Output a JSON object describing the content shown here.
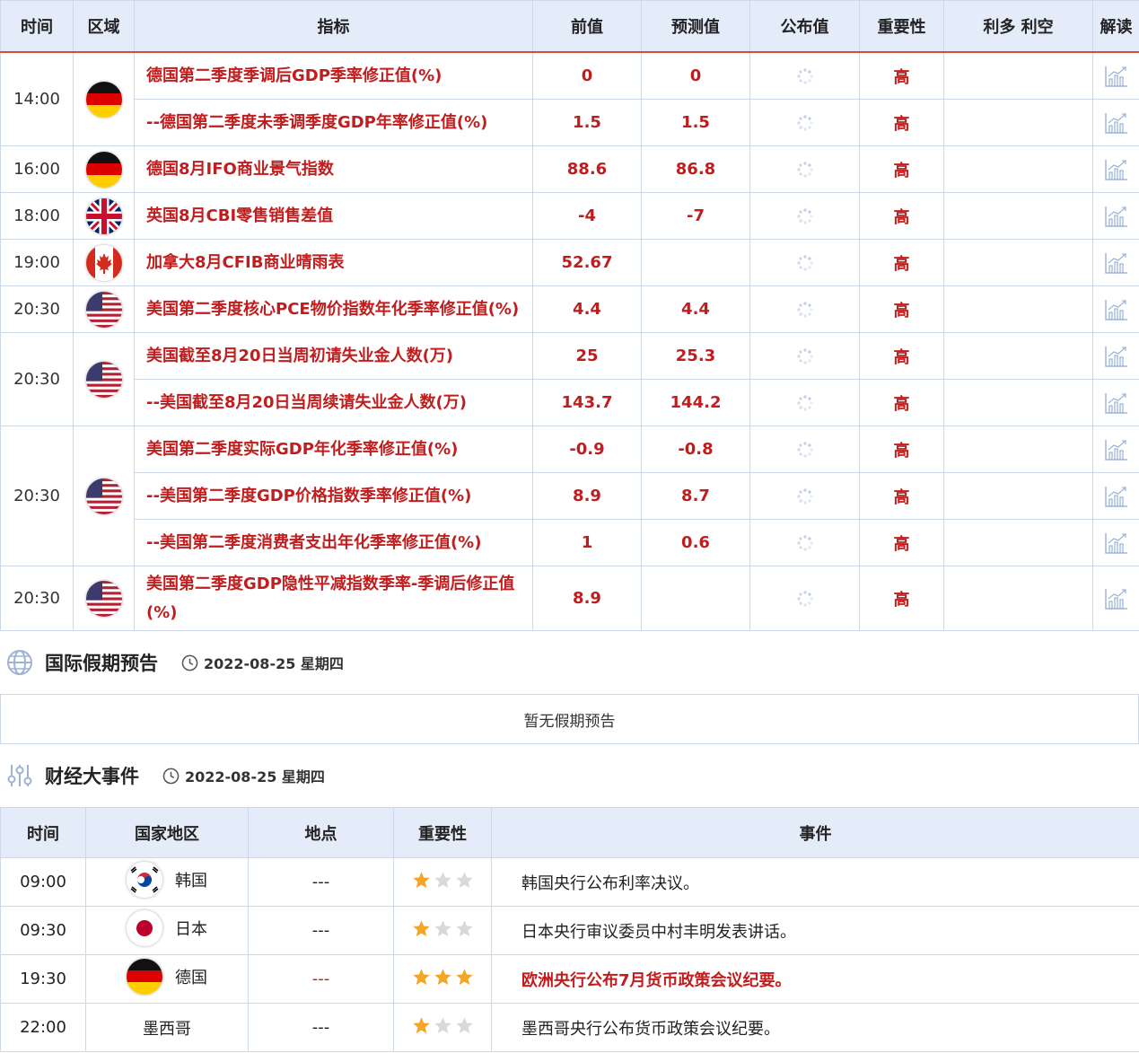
{
  "calendar": {
    "headers": [
      "时间",
      "区域",
      "指标",
      "前值",
      "预测值",
      "公布值",
      "重要性",
      "利多 利空",
      "解读"
    ],
    "rows": [
      {
        "time": "14:00",
        "flag": "germany",
        "indicator": "德国第二季度季调后GDP季率修正值(%)",
        "prev": "0",
        "forecast": "0",
        "importance": "高"
      },
      {
        "time": "",
        "flag": "",
        "indicator": "--德国第二季度未季调季度GDP年率修正值(%)",
        "prev": "1.5",
        "forecast": "1.5",
        "importance": "高"
      },
      {
        "time": "16:00",
        "flag": "germany",
        "indicator": "德国8月IFO商业景气指数",
        "prev": "88.6",
        "forecast": "86.8",
        "importance": "高"
      },
      {
        "time": "18:00",
        "flag": "uk",
        "indicator": "英国8月CBI零售销售差值",
        "prev": "-4",
        "forecast": "-7",
        "importance": "高"
      },
      {
        "time": "19:00",
        "flag": "canada",
        "indicator": "加拿大8月CFIB商业晴雨表",
        "prev": "52.67",
        "forecast": "",
        "importance": "高"
      },
      {
        "time": "20:30",
        "flag": "usa",
        "indicator": "美国第二季度核心PCE物价指数年化季率修正值(%)",
        "prev": "4.4",
        "forecast": "4.4",
        "importance": "高"
      },
      {
        "time": "20:30",
        "flag": "usa",
        "indicator": "美国截至8月20日当周初请失业金人数(万)",
        "prev": "25",
        "forecast": "25.3",
        "importance": "高"
      },
      {
        "time": "",
        "flag": "",
        "indicator": "--美国截至8月20日当周续请失业金人数(万)",
        "prev": "143.7",
        "forecast": "144.2",
        "importance": "高"
      },
      {
        "time": "20:30",
        "flag": "usa",
        "indicator": "美国第二季度实际GDP年化季率修正值(%)",
        "prev": "-0.9",
        "forecast": "-0.8",
        "importance": "高"
      },
      {
        "time": "",
        "flag": "",
        "indicator": "--美国第二季度GDP价格指数季率修正值(%)",
        "prev": "8.9",
        "forecast": "8.7",
        "importance": "高"
      },
      {
        "time": "",
        "flag": "",
        "indicator": "--美国第二季度消费者支出年化季率修正值(%)",
        "prev": "1",
        "forecast": "0.6",
        "importance": "高"
      },
      {
        "time": "20:30",
        "flag": "usa",
        "indicator": "美国第二季度GDP隐性平减指数季率-季调后修正值(%)",
        "prev": "8.9",
        "forecast": "",
        "importance": "高"
      }
    ]
  },
  "holiday": {
    "title": "国际假期预告",
    "date": "2022-08-25 星期四",
    "empty_text": "暂无假期预告"
  },
  "events": {
    "title": "财经大事件",
    "date": "2022-08-25 星期四",
    "headers": [
      "时间",
      "国家地区",
      "地点",
      "重要性",
      "事件"
    ],
    "rows": [
      {
        "time": "09:00",
        "flag": "korea",
        "country": "韩国",
        "place": "---",
        "stars": 1,
        "event": "韩国央行公布利率决议。",
        "hot": false
      },
      {
        "time": "09:30",
        "flag": "japan",
        "country": "日本",
        "place": "---",
        "stars": 1,
        "event": "日本央行审议委员中村丰明发表讲话。",
        "hot": false
      },
      {
        "time": "19:30",
        "flag": "germany",
        "country": "德国",
        "place": "---",
        "stars": 3,
        "event": "欧洲央行公布7月货币政策会议纪要。",
        "hot": true
      },
      {
        "time": "22:00",
        "flag": "",
        "country": "墨西哥",
        "place": "---",
        "stars": 1,
        "event": "墨西哥央行公布货币政策会议纪要。",
        "hot": false
      }
    ]
  },
  "colors": {
    "accent": "#c01e1e",
    "header_bg": "#e3ecf8",
    "border": "#cdd9e8",
    "star_on": "#f5a623",
    "star_off": "#d9d9d9"
  }
}
